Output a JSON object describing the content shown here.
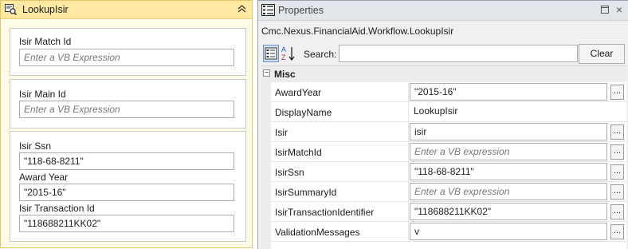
{
  "activity": {
    "title": "LookupIsir",
    "fields": [
      {
        "label": "Isir Match Id",
        "value": "",
        "placeholder": "Enter a VB Expression"
      },
      {
        "label": "Isir Main Id",
        "value": "",
        "placeholder": "Enter a VB Expression"
      },
      {
        "label": "Isir Ssn",
        "value": "\"118-68-8211\"",
        "placeholder": ""
      },
      {
        "label": "Award Year",
        "value": "\"2015-16\"",
        "placeholder": ""
      },
      {
        "label": "Isir Transaction Id",
        "value": "\"118688211KK02\"",
        "placeholder": ""
      }
    ]
  },
  "properties": {
    "title": "Properties",
    "close_glyph": "×",
    "type_name": "Cmc.Nexus.FinancialAid.Workflow.LookupIsir",
    "search_label": "Search:",
    "search_value": "",
    "clear_label": "Clear",
    "category_toggle": "−",
    "category": "Misc",
    "ellipsis": "...",
    "rows": [
      {
        "name": "AwardYear",
        "value": "\"2015-16\"",
        "placeholder": ""
      },
      {
        "name": "DisplayName",
        "value": "LookupIsir",
        "placeholder": ""
      },
      {
        "name": "Isir",
        "value": "isir",
        "placeholder": ""
      },
      {
        "name": "IsirMatchId",
        "value": "",
        "placeholder": "Enter a VB expression"
      },
      {
        "name": "IsirSsn",
        "value": "\"118-68-8211\"",
        "placeholder": ""
      },
      {
        "name": "IsirSummaryId",
        "value": "",
        "placeholder": "Enter a VB expression"
      },
      {
        "name": "IsirTransactionIdentifier",
        "value": "\"118688211KK02\"",
        "placeholder": ""
      },
      {
        "name": "ValidationMessages",
        "value": "v",
        "placeholder": ""
      }
    ]
  }
}
